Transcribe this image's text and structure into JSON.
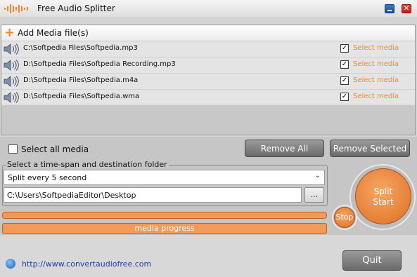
{
  "window": {
    "title": "Free Audio Splitter",
    "close_glyph": "✕",
    "logo_icon": "audio-waveform-icon"
  },
  "media": {
    "add_label": "Add Media file(s)",
    "add_glyph": "+",
    "select_link_label": "Select media",
    "check_glyph": "✓",
    "files": [
      {
        "path": "C:\\Softpedia Files\\Softpedia.mp3",
        "checked": true
      },
      {
        "path": "D:\\Softpedia Files\\Softpedia Recording.mp3",
        "checked": true
      },
      {
        "path": "D:\\Softpedia Files\\Softpedia.m4a",
        "checked": true
      },
      {
        "path": "D:\\Softpedia Files\\Softpedia.wma",
        "checked": true
      }
    ]
  },
  "controls": {
    "select_all_label": "Select all media",
    "select_all_checked": false,
    "remove_all_label": "Remove All",
    "remove_selected_label": "Remove Selected"
  },
  "options": {
    "group_label": "Select a time-span and destination folder",
    "split_mode": "Split every 5 second",
    "dropdown_arrow": "⌄",
    "destination": "C:\\Users\\SoftpediaEditor\\Desktop",
    "browse_label": "..."
  },
  "progress": {
    "media_progress_label": "media progress"
  },
  "actions": {
    "split_line1": "Split",
    "split_line2": "Start",
    "stop_label": "Stop"
  },
  "footer": {
    "url": "http://www.convertaudiofree.com",
    "quit_label": "Quit"
  },
  "colors": {
    "accent_orange": "#f08a28",
    "progress_orange": "#f39a57",
    "link_blue": "#1b3fa8"
  }
}
